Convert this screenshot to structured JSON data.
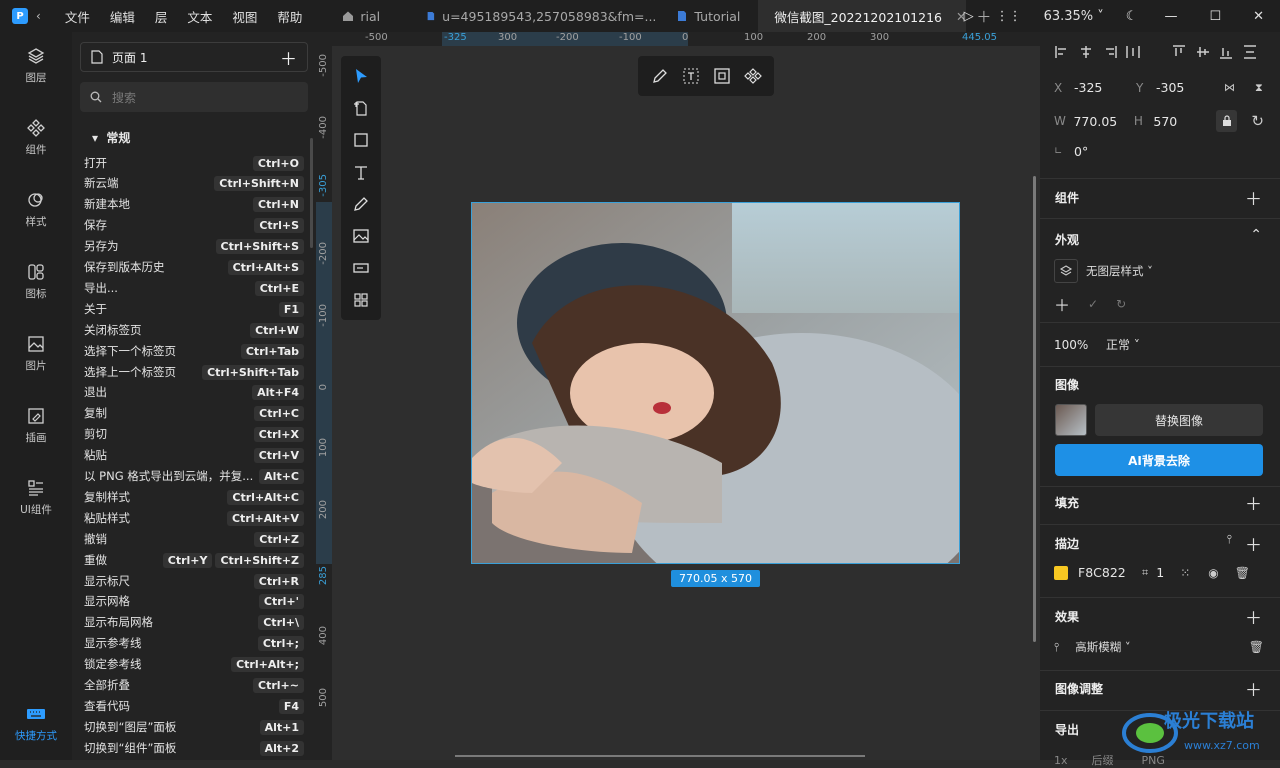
{
  "window": {
    "menu": [
      "文件",
      "编辑",
      "层",
      "文本",
      "视图",
      "帮助"
    ],
    "tabs": [
      {
        "label": "rial"
      },
      {
        "label": "u=495189543,257058983&fm=..."
      },
      {
        "label": "Tutorial"
      },
      {
        "label": "微信截图_20221202101216",
        "active": true
      }
    ],
    "zoom": "63.35%"
  },
  "left_rail": [
    {
      "label": "图层",
      "icon": "layers-icon"
    },
    {
      "label": "组件",
      "icon": "components-icon"
    },
    {
      "label": "样式",
      "icon": "styles-icon"
    },
    {
      "label": "图标",
      "icon": "icons-icon"
    },
    {
      "label": "图片",
      "icon": "image-icon"
    },
    {
      "label": "插画",
      "icon": "illustration-icon"
    },
    {
      "label": "UI组件",
      "icon": "ui-components-icon"
    },
    {
      "label": "快捷方式",
      "icon": "keyboard-icon",
      "active": true
    }
  ],
  "panel": {
    "page_label": "页面 1",
    "search_placeholder": "搜索",
    "section": "常规",
    "shortcuts": [
      {
        "name": "打开",
        "keys": [
          "Ctrl+O"
        ]
      },
      {
        "name": "新云端",
        "keys": [
          "Ctrl+Shift+N"
        ]
      },
      {
        "name": "新建本地",
        "keys": [
          "Ctrl+N"
        ]
      },
      {
        "name": "保存",
        "keys": [
          "Ctrl+S"
        ]
      },
      {
        "name": "另存为",
        "keys": [
          "Ctrl+Shift+S"
        ]
      },
      {
        "name": "保存到版本历史",
        "keys": [
          "Ctrl+Alt+S"
        ]
      },
      {
        "name": "导出...",
        "keys": [
          "Ctrl+E"
        ]
      },
      {
        "name": "关于",
        "keys": [
          "F1"
        ]
      },
      {
        "name": "关闭标签页",
        "keys": [
          "Ctrl+W"
        ]
      },
      {
        "name": "选择下一个标签页",
        "keys": [
          "Ctrl+Tab"
        ]
      },
      {
        "name": "选择上一个标签页",
        "keys": [
          "Ctrl+Shift+Tab"
        ]
      },
      {
        "name": "退出",
        "keys": [
          "Alt+F4"
        ]
      },
      {
        "name": "复制",
        "keys": [
          "Ctrl+C"
        ]
      },
      {
        "name": "剪切",
        "keys": [
          "Ctrl+X"
        ]
      },
      {
        "name": "粘贴",
        "keys": [
          "Ctrl+V"
        ]
      },
      {
        "name": "以 PNG 格式导出到云端，并复...",
        "keys": [
          "Alt+C"
        ]
      },
      {
        "name": "复制样式",
        "keys": [
          "Ctrl+Alt+C"
        ]
      },
      {
        "name": "粘贴样式",
        "keys": [
          "Ctrl+Alt+V"
        ]
      },
      {
        "name": "撤销",
        "keys": [
          "Ctrl+Z"
        ]
      },
      {
        "name": "重做",
        "keys": [
          "Ctrl+Y",
          "Ctrl+Shift+Z"
        ]
      },
      {
        "name": "显示标尺",
        "keys": [
          "Ctrl+R"
        ]
      },
      {
        "name": "显示网格",
        "keys": [
          "Ctrl+'"
        ]
      },
      {
        "name": "显示布局网格",
        "keys": [
          "Ctrl+\\"
        ]
      },
      {
        "name": "显示参考线",
        "keys": [
          "Ctrl+;"
        ]
      },
      {
        "name": "锁定参考线",
        "keys": [
          "Ctrl+Alt+;"
        ]
      },
      {
        "name": "全部折叠",
        "keys": [
          "Ctrl+~"
        ]
      },
      {
        "name": "查看代码",
        "keys": [
          "F4"
        ]
      },
      {
        "name": "切换到“图层”面板",
        "keys": [
          "Alt+1"
        ]
      },
      {
        "name": "切换到“组件”面板",
        "keys": [
          "Alt+2"
        ]
      }
    ]
  },
  "ruler": {
    "top": [
      "-500",
      "-325",
      "300",
      "-200",
      "-100",
      "0",
      "100",
      "200",
      "300",
      "445.05"
    ],
    "left": [
      "-500",
      "-400",
      "-305",
      "-200",
      "-100",
      "0",
      "100",
      "200",
      "285",
      "400",
      "500"
    ]
  },
  "canvas": {
    "size_badge": "770.05 x 570"
  },
  "inspector": {
    "x_label": "X",
    "x": "-325",
    "y_label": "Y",
    "y": "-305",
    "w_label": "W",
    "w": "770.05",
    "h_label": "H",
    "h": "570",
    "rotation": "0°",
    "components": "组件",
    "appearance": "外观",
    "layer_style": "无图层样式",
    "opacity": "100%",
    "blend": "正常",
    "image": "图像",
    "replace_image": "替换图像",
    "ai_remove_bg": "AI背景去除",
    "fill": "填充",
    "stroke": "描边",
    "stroke_color": "F8C822",
    "stroke_color_hex": "#F8C822",
    "stroke_width": "1",
    "effects": "效果",
    "effect_name": "高斯模糊",
    "image_adjust": "图像调整",
    "export": "导出",
    "export_scale": "1x",
    "export_suffix": "后缀",
    "export_format": "PNG"
  },
  "watermark": {
    "text": "极光下载站",
    "url": "www.xz7.com"
  },
  "colors": {
    "accent": "#1f8fdd",
    "ai_button": "#1e90e6"
  }
}
